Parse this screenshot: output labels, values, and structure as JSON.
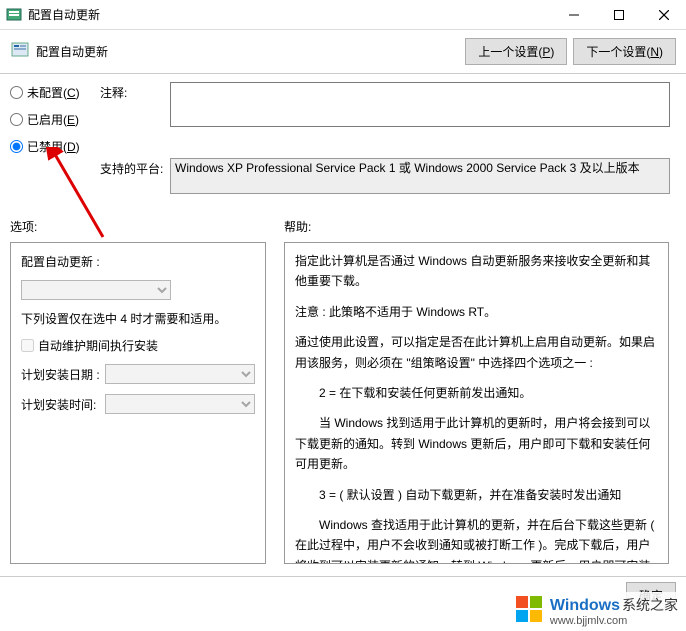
{
  "window": {
    "title": "配置自动更新"
  },
  "toolbar": {
    "title": "配置自动更新",
    "prev_btn": "上一个设置(P)",
    "next_btn": "下一个设置(N)"
  },
  "radios": {
    "not_configured": "未配置(C)",
    "enabled": "已启用(E)",
    "disabled": "已禁用(D)",
    "selected": "disabled"
  },
  "comment": {
    "label": "注释:",
    "value": ""
  },
  "platform": {
    "label": "支持的平台:",
    "value": "Windows XP Professional Service Pack 1 或 Windows 2000 Service Pack 3 及以上版本"
  },
  "options": {
    "heading": "选项:",
    "configure_label": "配置自动更新 :",
    "configure_value": "",
    "note": "下列设置仅在选中 4 时才需要和适用。",
    "maintenance_checkbox": "自动维护期间执行安装",
    "maintenance_checked": false,
    "schedule_day_label": "计划安装日期 :",
    "schedule_day_value": "",
    "schedule_time_label": "计划安装时间:",
    "schedule_time_value": ""
  },
  "help": {
    "heading": "帮助:",
    "paragraphs": [
      "指定此计算机是否通过 Windows 自动更新服务来接收安全更新和其他重要下载。",
      "注意 : 此策略不适用于 Windows RT。",
      "通过使用此设置，可以指定是否在此计算机上启用自动更新。如果启用该服务，则必须在 \"组策略设置\" 中选择四个选项之一 :",
      "2 = 在下载和安装任何更新前发出通知。",
      "当 Windows 找到适用于此计算机的更新时，用户将会接到可以下载更新的通知。转到 Windows 更新后，用户即可下载和安装任何可用更新。",
      "3 = ( 默认设置 ) 自动下载更新，并在准备安装时发出通知",
      "Windows 查找适用于此计算机的更新，并在后台下载这些更新 ( 在此过程中，用户不会收到通知或被打断工作 )。完成下载后，用户将收到可以安装更新的通知。转到 Windows 更新后，用户即可安装更新。"
    ],
    "indent_flags": [
      false,
      false,
      false,
      true,
      true,
      true,
      true
    ]
  },
  "bottom": {
    "ok": "确定"
  },
  "watermark": {
    "brand": "Windows",
    "suffix": "系统之家",
    "url": "www.bjjmlv.com"
  }
}
